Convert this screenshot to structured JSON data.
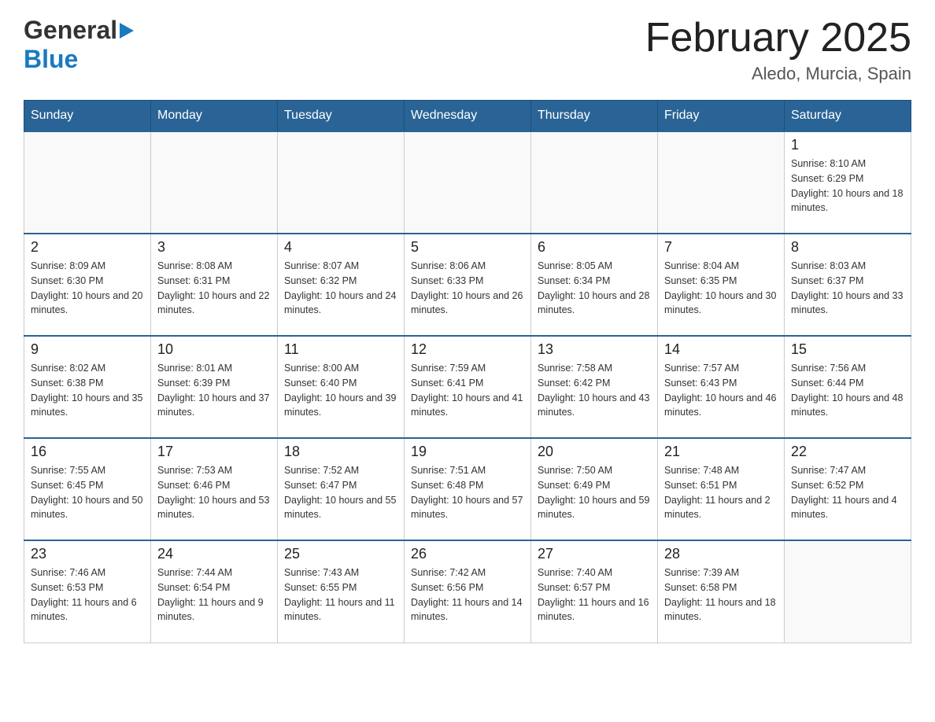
{
  "header": {
    "logo_general": "General",
    "logo_blue": "Blue",
    "month_title": "February 2025",
    "location": "Aledo, Murcia, Spain"
  },
  "days_of_week": [
    "Sunday",
    "Monday",
    "Tuesday",
    "Wednesday",
    "Thursday",
    "Friday",
    "Saturday"
  ],
  "weeks": [
    {
      "days": [
        {
          "number": "",
          "info": ""
        },
        {
          "number": "",
          "info": ""
        },
        {
          "number": "",
          "info": ""
        },
        {
          "number": "",
          "info": ""
        },
        {
          "number": "",
          "info": ""
        },
        {
          "number": "",
          "info": ""
        },
        {
          "number": "1",
          "info": "Sunrise: 8:10 AM\nSunset: 6:29 PM\nDaylight: 10 hours and 18 minutes."
        }
      ]
    },
    {
      "days": [
        {
          "number": "2",
          "info": "Sunrise: 8:09 AM\nSunset: 6:30 PM\nDaylight: 10 hours and 20 minutes."
        },
        {
          "number": "3",
          "info": "Sunrise: 8:08 AM\nSunset: 6:31 PM\nDaylight: 10 hours and 22 minutes."
        },
        {
          "number": "4",
          "info": "Sunrise: 8:07 AM\nSunset: 6:32 PM\nDaylight: 10 hours and 24 minutes."
        },
        {
          "number": "5",
          "info": "Sunrise: 8:06 AM\nSunset: 6:33 PM\nDaylight: 10 hours and 26 minutes."
        },
        {
          "number": "6",
          "info": "Sunrise: 8:05 AM\nSunset: 6:34 PM\nDaylight: 10 hours and 28 minutes."
        },
        {
          "number": "7",
          "info": "Sunrise: 8:04 AM\nSunset: 6:35 PM\nDaylight: 10 hours and 30 minutes."
        },
        {
          "number": "8",
          "info": "Sunrise: 8:03 AM\nSunset: 6:37 PM\nDaylight: 10 hours and 33 minutes."
        }
      ]
    },
    {
      "days": [
        {
          "number": "9",
          "info": "Sunrise: 8:02 AM\nSunset: 6:38 PM\nDaylight: 10 hours and 35 minutes."
        },
        {
          "number": "10",
          "info": "Sunrise: 8:01 AM\nSunset: 6:39 PM\nDaylight: 10 hours and 37 minutes."
        },
        {
          "number": "11",
          "info": "Sunrise: 8:00 AM\nSunset: 6:40 PM\nDaylight: 10 hours and 39 minutes."
        },
        {
          "number": "12",
          "info": "Sunrise: 7:59 AM\nSunset: 6:41 PM\nDaylight: 10 hours and 41 minutes."
        },
        {
          "number": "13",
          "info": "Sunrise: 7:58 AM\nSunset: 6:42 PM\nDaylight: 10 hours and 43 minutes."
        },
        {
          "number": "14",
          "info": "Sunrise: 7:57 AM\nSunset: 6:43 PM\nDaylight: 10 hours and 46 minutes."
        },
        {
          "number": "15",
          "info": "Sunrise: 7:56 AM\nSunset: 6:44 PM\nDaylight: 10 hours and 48 minutes."
        }
      ]
    },
    {
      "days": [
        {
          "number": "16",
          "info": "Sunrise: 7:55 AM\nSunset: 6:45 PM\nDaylight: 10 hours and 50 minutes."
        },
        {
          "number": "17",
          "info": "Sunrise: 7:53 AM\nSunset: 6:46 PM\nDaylight: 10 hours and 53 minutes."
        },
        {
          "number": "18",
          "info": "Sunrise: 7:52 AM\nSunset: 6:47 PM\nDaylight: 10 hours and 55 minutes."
        },
        {
          "number": "19",
          "info": "Sunrise: 7:51 AM\nSunset: 6:48 PM\nDaylight: 10 hours and 57 minutes."
        },
        {
          "number": "20",
          "info": "Sunrise: 7:50 AM\nSunset: 6:49 PM\nDaylight: 10 hours and 59 minutes."
        },
        {
          "number": "21",
          "info": "Sunrise: 7:48 AM\nSunset: 6:51 PM\nDaylight: 11 hours and 2 minutes."
        },
        {
          "number": "22",
          "info": "Sunrise: 7:47 AM\nSunset: 6:52 PM\nDaylight: 11 hours and 4 minutes."
        }
      ]
    },
    {
      "days": [
        {
          "number": "23",
          "info": "Sunrise: 7:46 AM\nSunset: 6:53 PM\nDaylight: 11 hours and 6 minutes."
        },
        {
          "number": "24",
          "info": "Sunrise: 7:44 AM\nSunset: 6:54 PM\nDaylight: 11 hours and 9 minutes."
        },
        {
          "number": "25",
          "info": "Sunrise: 7:43 AM\nSunset: 6:55 PM\nDaylight: 11 hours and 11 minutes."
        },
        {
          "number": "26",
          "info": "Sunrise: 7:42 AM\nSunset: 6:56 PM\nDaylight: 11 hours and 14 minutes."
        },
        {
          "number": "27",
          "info": "Sunrise: 7:40 AM\nSunset: 6:57 PM\nDaylight: 11 hours and 16 minutes."
        },
        {
          "number": "28",
          "info": "Sunrise: 7:39 AM\nSunset: 6:58 PM\nDaylight: 11 hours and 18 minutes."
        },
        {
          "number": "",
          "info": ""
        }
      ]
    }
  ]
}
